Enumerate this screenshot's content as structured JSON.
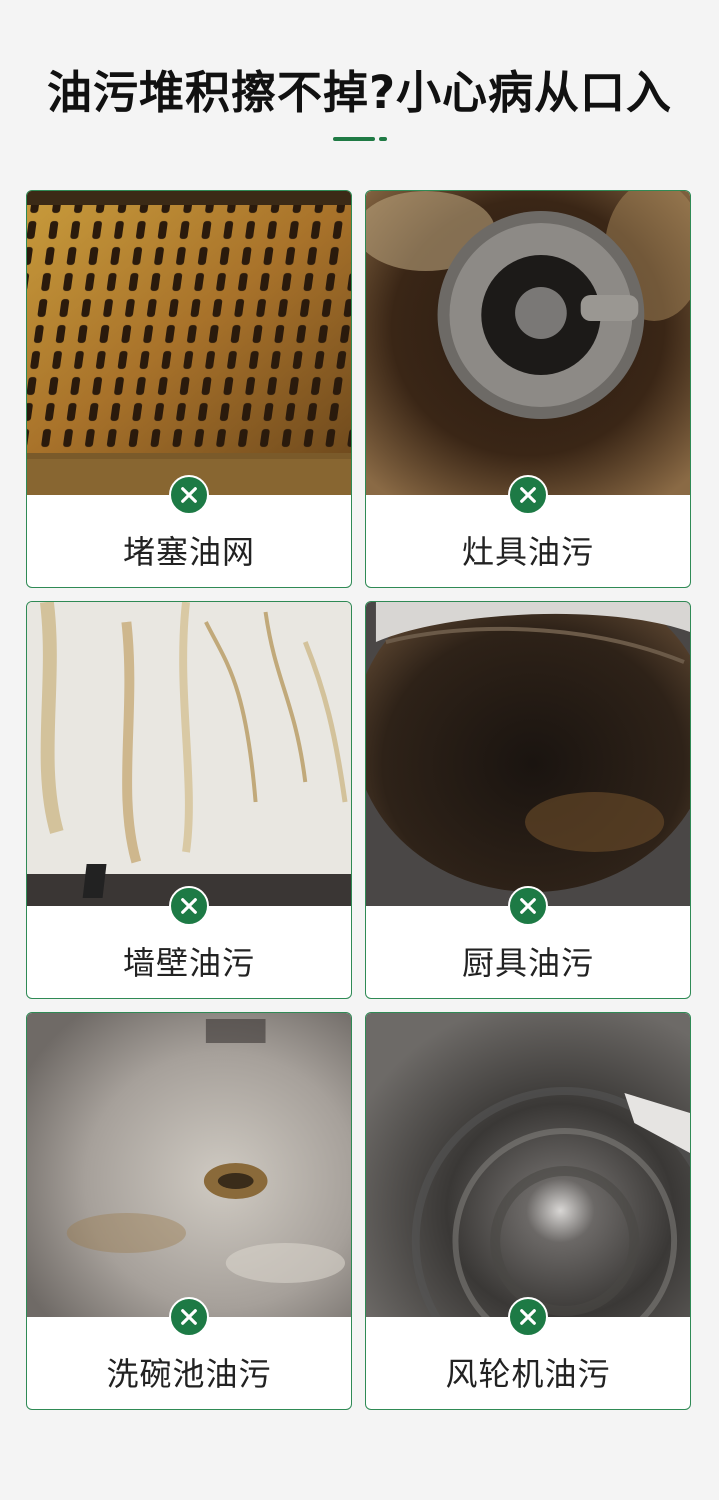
{
  "headline": "油污堆积擦不掉?小心病从口入",
  "colors": {
    "accent": "#1d7a45",
    "card_border": "#2f8a55"
  },
  "cards": [
    {
      "label": "堵塞油网",
      "icon": "x-icon"
    },
    {
      "label": "灶具油污",
      "icon": "x-icon"
    },
    {
      "label": "墙壁油污",
      "icon": "x-icon"
    },
    {
      "label": "厨具油污",
      "icon": "x-icon"
    },
    {
      "label": "洗碗池油污",
      "icon": "x-icon"
    },
    {
      "label": "风轮机油污",
      "icon": "x-icon"
    }
  ]
}
